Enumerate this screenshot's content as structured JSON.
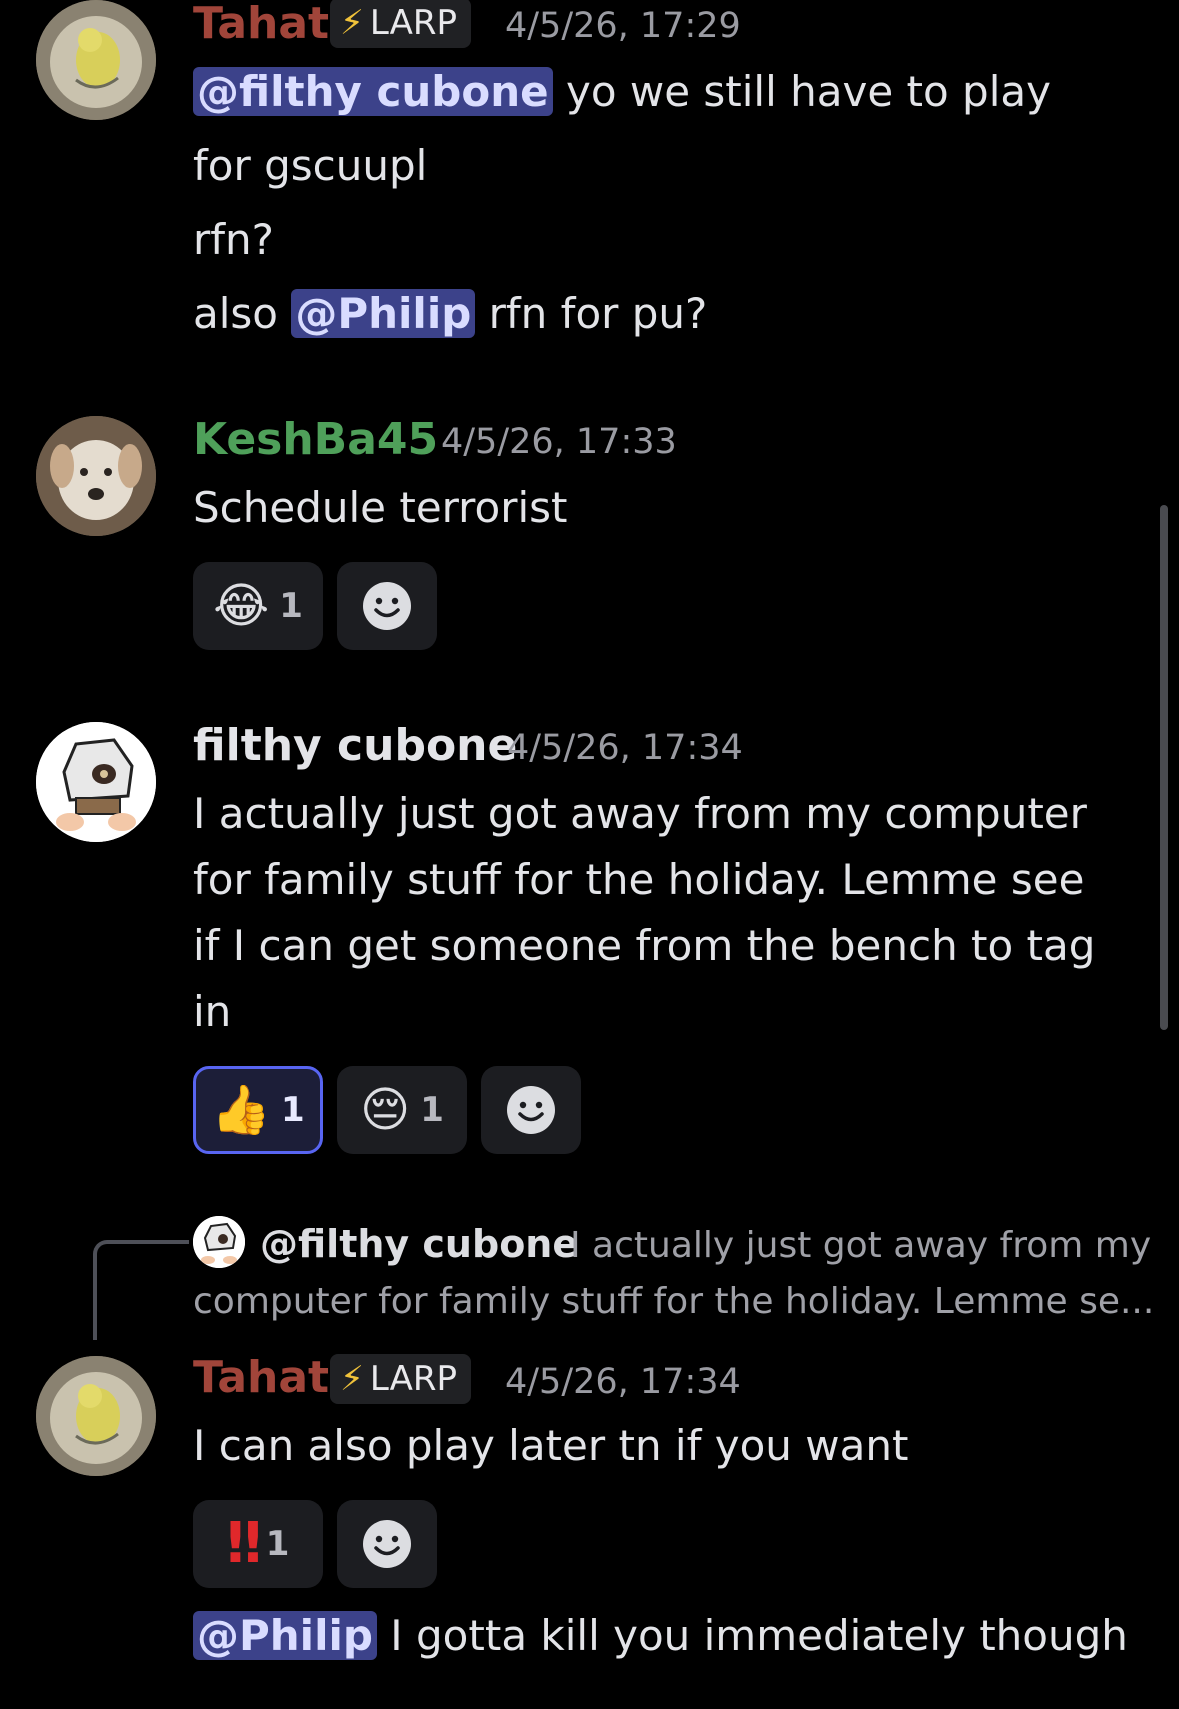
{
  "colors": {
    "background": "#000000",
    "tahat_name": "#a1453a",
    "keshba_name": "#4fa05a",
    "filthy_name": "#e3e4e8",
    "mention_bg": "#3c428a",
    "active_reaction_border": "#5865f2",
    "larp_bolt": "#f0c23a"
  },
  "messages": [
    {
      "author": "Tahat",
      "tag": "LARP",
      "tag_icon": "lightning-bolt",
      "timestamp": "4/5/26, 17:29",
      "lines": [
        {
          "mention": "@filthy cubone",
          "text": " yo we still have to play"
        },
        {
          "text": "for gscuupl"
        },
        {
          "text": "rfn?"
        },
        {
          "pre": "also ",
          "mention": "@Philip",
          "text": " rfn for pu?"
        }
      ]
    },
    {
      "author": "KeshBa45",
      "timestamp": "4/5/26, 17:33",
      "lines": [
        {
          "text": "Schedule terrorist"
        }
      ],
      "reactions": [
        {
          "emoji": "😂",
          "count": "1"
        }
      ]
    },
    {
      "author": "filthy cubone",
      "timestamp": "4/5/26, 17:34",
      "lines": [
        {
          "text": "I actually just got away from my computer"
        },
        {
          "text": "for family stuff for the holiday. Lemme see"
        },
        {
          "text": "if I can get someone from the bench to tag"
        },
        {
          "text": "in"
        }
      ],
      "reactions": [
        {
          "emoji": "👍",
          "count": "1",
          "active": true
        },
        {
          "emoji": "😔",
          "count": "1"
        }
      ]
    },
    {
      "reply": {
        "mention": "@filthy cubone",
        "line1": "I actually just got away from my",
        "line2": "computer for family stuff for the holiday. Lemme se..."
      },
      "author": "Tahat",
      "tag": "LARP",
      "tag_icon": "lightning-bolt",
      "timestamp": "4/5/26, 17:34",
      "lines": [
        {
          "text": "I can also play later tn if you want"
        }
      ],
      "reactions": [
        {
          "emoji": "‼",
          "emoji_name": "double-exclamation",
          "count": "1"
        }
      ],
      "followup": {
        "mention": "@Philip",
        "text": " I gotta kill you immediately though"
      }
    }
  ]
}
